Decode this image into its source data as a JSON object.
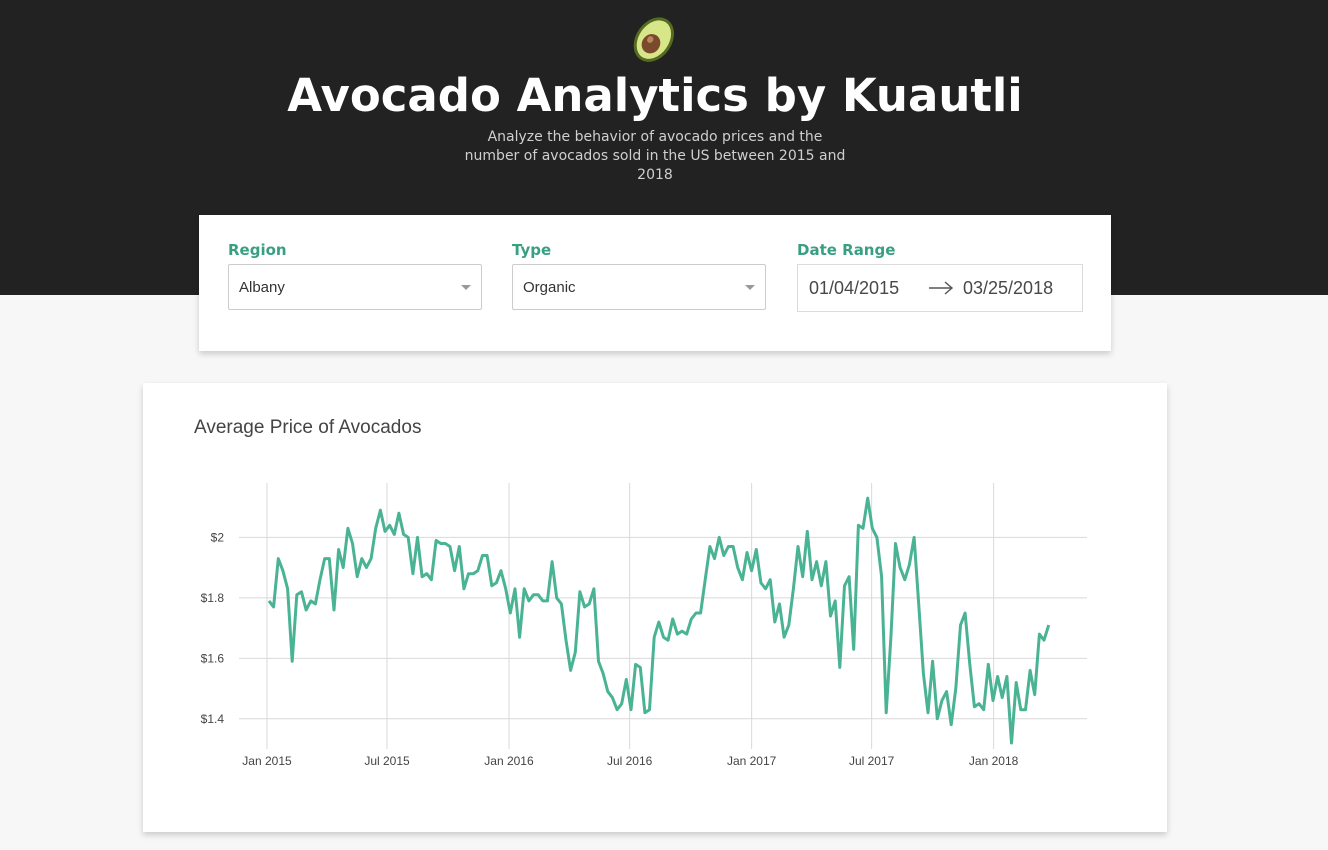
{
  "header": {
    "logo_icon": "avocado-icon",
    "title": "Avocado Analytics by Kuautli",
    "subtitle": "Analyze the behavior of avocado prices and the number of avocados sold in the US between 2015 and 2018"
  },
  "filters": {
    "region": {
      "label": "Region",
      "value": "Albany"
    },
    "type": {
      "label": "Type",
      "value": "Organic"
    },
    "date_range": {
      "label": "Date Range",
      "start": "01/04/2015",
      "end": "03/25/2018"
    }
  },
  "colors": {
    "accent": "#389f83",
    "line": "#4ab394",
    "header_bg": "#222222"
  },
  "chart_data": {
    "type": "line",
    "title": "Average Price of Avocados",
    "xlabel": "",
    "ylabel": "",
    "x_ticks": [
      "Jan 2015",
      "Jul 2015",
      "Jan 2016",
      "Jul 2016",
      "Jan 2017",
      "Jul 2017",
      "Jan 2018"
    ],
    "y_ticks": [
      "$1.4",
      "$1.6",
      "$1.8",
      "$2"
    ],
    "ylim": [
      1.3,
      2.18
    ],
    "grid": true,
    "start_date": "2015-01-04",
    "interval_days": 7,
    "series": [
      {
        "values": [
          1.79,
          1.77,
          1.93,
          1.89,
          1.83,
          1.59,
          1.81,
          1.82,
          1.76,
          1.79,
          1.78,
          1.86,
          1.93,
          1.93,
          1.76,
          1.96,
          1.9,
          2.03,
          1.98,
          1.87,
          1.93,
          1.9,
          1.93,
          2.03,
          2.09,
          2.02,
          2.04,
          2.01,
          2.08,
          2.01,
          2.0,
          1.88,
          2.0,
          1.87,
          1.88,
          1.86,
          1.99,
          1.98,
          1.98,
          1.97,
          1.89,
          1.97,
          1.83,
          1.88,
          1.88,
          1.89,
          1.94,
          1.94,
          1.84,
          1.85,
          1.89,
          1.83,
          1.75,
          1.83,
          1.67,
          1.83,
          1.79,
          1.81,
          1.81,
          1.79,
          1.79,
          1.92,
          1.8,
          1.78,
          1.66,
          1.56,
          1.62,
          1.82,
          1.77,
          1.78,
          1.83,
          1.59,
          1.55,
          1.49,
          1.47,
          1.43,
          1.45,
          1.53,
          1.43,
          1.58,
          1.57,
          1.42,
          1.43,
          1.67,
          1.72,
          1.67,
          1.66,
          1.73,
          1.68,
          1.69,
          1.68,
          1.73,
          1.75,
          1.75,
          1.86,
          1.97,
          1.93,
          2.0,
          1.94,
          1.97,
          1.97,
          1.9,
          1.86,
          1.95,
          1.89,
          1.96,
          1.85,
          1.83,
          1.86,
          1.72,
          1.78,
          1.67,
          1.71,
          1.83,
          1.97,
          1.87,
          2.02,
          1.86,
          1.92,
          1.84,
          1.92,
          1.74,
          1.79,
          1.57,
          1.84,
          1.87,
          1.63,
          2.04,
          2.03,
          2.13,
          2.03,
          2.0,
          1.87,
          1.42,
          1.67,
          1.98,
          1.9,
          1.86,
          1.91,
          2.0,
          1.78,
          1.55,
          1.42,
          1.59,
          1.4,
          1.46,
          1.49,
          1.38,
          1.5,
          1.71,
          1.75,
          1.58,
          1.44,
          1.45,
          1.43,
          1.58,
          1.46,
          1.54,
          1.47,
          1.54,
          1.32,
          1.52,
          1.43,
          1.43,
          1.56,
          1.48,
          1.68,
          1.66,
          1.71
        ]
      }
    ]
  }
}
